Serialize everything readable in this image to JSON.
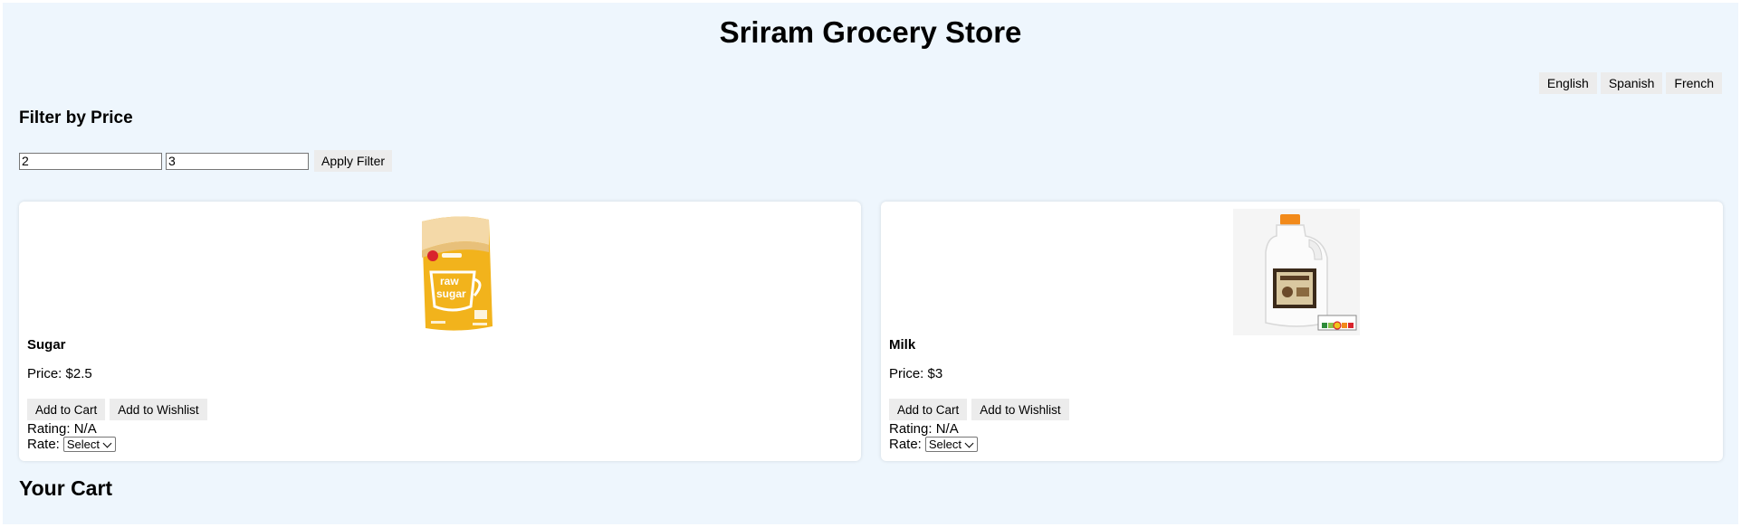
{
  "header": {
    "title": "Sriram Grocery Store"
  },
  "languages": [
    "English",
    "Spanish",
    "French"
  ],
  "filter": {
    "heading": "Filter by Price",
    "min_value": "2",
    "max_value": "3",
    "apply_label": "Apply Filter"
  },
  "products": [
    {
      "name": "Sugar",
      "price_text": "Price: $2.5",
      "add_to_cart": "Add to Cart",
      "add_to_wishlist": "Add to Wishlist",
      "rating_text": "Rating: N/A",
      "rate_label": "Rate:",
      "rate_selected": "Select",
      "image_text": [
        "raw",
        "sugar"
      ]
    },
    {
      "name": "Milk",
      "price_text": "Price: $3",
      "add_to_cart": "Add to Cart",
      "add_to_wishlist": "Add to Wishlist",
      "rating_text": "Rating: N/A",
      "rate_label": "Rate:",
      "rate_selected": "Select"
    }
  ],
  "cart": {
    "heading": "Your Cart"
  },
  "colors": {
    "page_background": "#eef6fd",
    "card_background": "#ffffff",
    "button_background": "#ececec",
    "sugar_pack": "#f2b31c",
    "milk_cap": "#f28a1a"
  }
}
